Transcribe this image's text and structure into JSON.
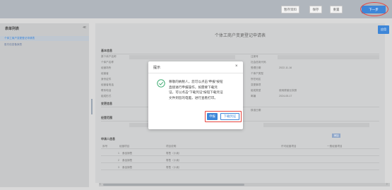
{
  "header": {
    "buttons": [
      "暂存资料",
      "保存",
      "重置",
      "下一步"
    ]
  },
  "sidebar": {
    "title": "表单列表",
    "collapse": "≪",
    "items": [
      "个体工商户变更登记申请表",
      "股东信息备案表"
    ]
  },
  "main": {
    "apply_label": "应用",
    "form_title": "个体工商户变更登记申请表",
    "sections": [
      "基本信息",
      "变更信息",
      "经营范围",
      "申请人信息"
    ],
    "left_rows": [
      "原个体户名称",
      "个体户名称",
      "经营场所",
      "经营者",
      "身份证件",
      "经营者电话",
      "联系电话",
      "组成形式"
    ],
    "right_rows": [
      "注册号",
      "社会信用代码",
      "受理日期",
      "个体户类型",
      "所在地区",
      "变更事项",
      "组成类型",
      "邮编",
      "核准日期"
    ],
    "right_values": [
      "",
      "",
      "2022-11-16",
      "",
      "",
      "",
      "使用原营业执照",
      "2024-05-17",
      ""
    ],
    "table_headers": [
      "序号",
      "经营项目",
      "项目说明",
      "许可经营项目",
      "一般经营项目"
    ],
    "table_rows": [
      [
        "1",
        "食品销售",
        "零售（小卖）"
      ],
      [
        "2",
        "食品销售",
        "零售（小卖）"
      ],
      [
        "3",
        "食品销售",
        "零售（小卖）"
      ]
    ],
    "add_label": "添加"
  },
  "modal": {
    "title": "提示",
    "close": "×",
    "message_lines": [
      "尊敬的纳税人，您可以点击“申报”按钮",
      "直接进行申报操作，如需要下载凭",
      "证，可以点击“下载凭证”按钮下载凭证",
      "文件到您的电脑，进行查看打印。"
    ],
    "confirm_label": "申报",
    "download_label": "下载凭证"
  },
  "colors": {
    "primary": "#3d86d8",
    "highlight": "#e6453f",
    "success": "#2ea566"
  }
}
